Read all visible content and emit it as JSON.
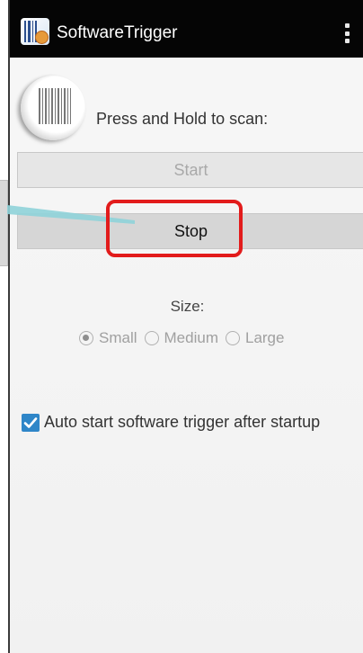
{
  "action_bar": {
    "title": "SoftwareTrigger",
    "app_icon": "app-barcode-icon",
    "menu_icon": "overflow-menu-icon",
    "background": "#050505"
  },
  "scanner": {
    "icon": "barcode-scanner-icon",
    "prompt": "Press and Hold to scan:"
  },
  "buttons": {
    "start_label": "Start",
    "stop_label": "Stop"
  },
  "size": {
    "label": "Size:",
    "options": [
      {
        "label": "Small",
        "checked": true
      },
      {
        "label": "Medium",
        "checked": false
      },
      {
        "label": "Large",
        "checked": false
      }
    ]
  },
  "auto_start": {
    "label": "Auto start software trigger after startup",
    "checked": true,
    "color": "#2f86c8"
  },
  "annotation": {
    "highlight_color": "#e21b1b",
    "pointer_color": "#8fd3d9"
  }
}
